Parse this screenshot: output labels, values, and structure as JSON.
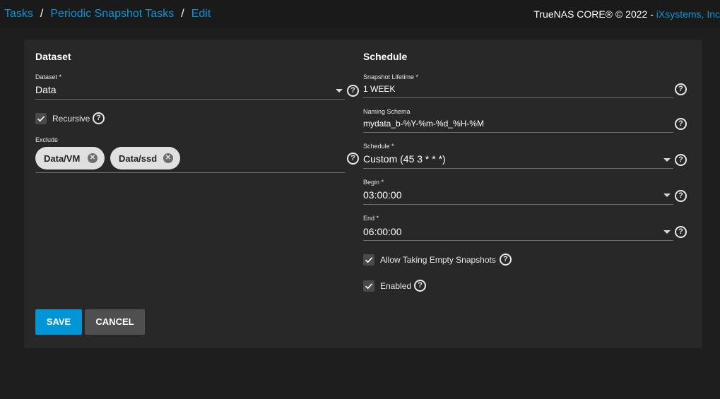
{
  "breadcrumb": {
    "items": [
      "Tasks",
      "Periodic Snapshot Tasks",
      "Edit"
    ],
    "separator": "/"
  },
  "brand": {
    "text": "TrueNAS CORE® © 2022 - ",
    "link": "iXsystems, Inc"
  },
  "dataset_section": {
    "title": "Dataset",
    "dataset": {
      "label": "Dataset *",
      "value": "Data"
    },
    "recursive": {
      "label": "Recursive",
      "checked": true
    },
    "exclude": {
      "label": "Exclude",
      "chips": [
        "Data/VM",
        "Data/ssd"
      ]
    }
  },
  "schedule_section": {
    "title": "Schedule",
    "lifetime": {
      "label": "Snapshot Lifetime *",
      "value": "1 WEEK"
    },
    "naming": {
      "label": "Naming Schema",
      "value": "mydata_b-%Y-%m-%d_%H-%M"
    },
    "schedule": {
      "label": "Schedule *",
      "value": "Custom (45 3 * * *)"
    },
    "begin": {
      "label": "Begin *",
      "value": "03:00:00"
    },
    "end": {
      "label": "End *",
      "value": "06:00:00"
    },
    "allow_empty": {
      "label": "Allow Taking Empty Snapshots",
      "checked": true
    },
    "enabled": {
      "label": "Enabled",
      "checked": true
    }
  },
  "actions": {
    "save": "SAVE",
    "cancel": "CANCEL"
  },
  "colors": {
    "accent": "#0095d5",
    "link": "#0e93d4",
    "card": "#282828",
    "background": "#1e1e1e"
  }
}
